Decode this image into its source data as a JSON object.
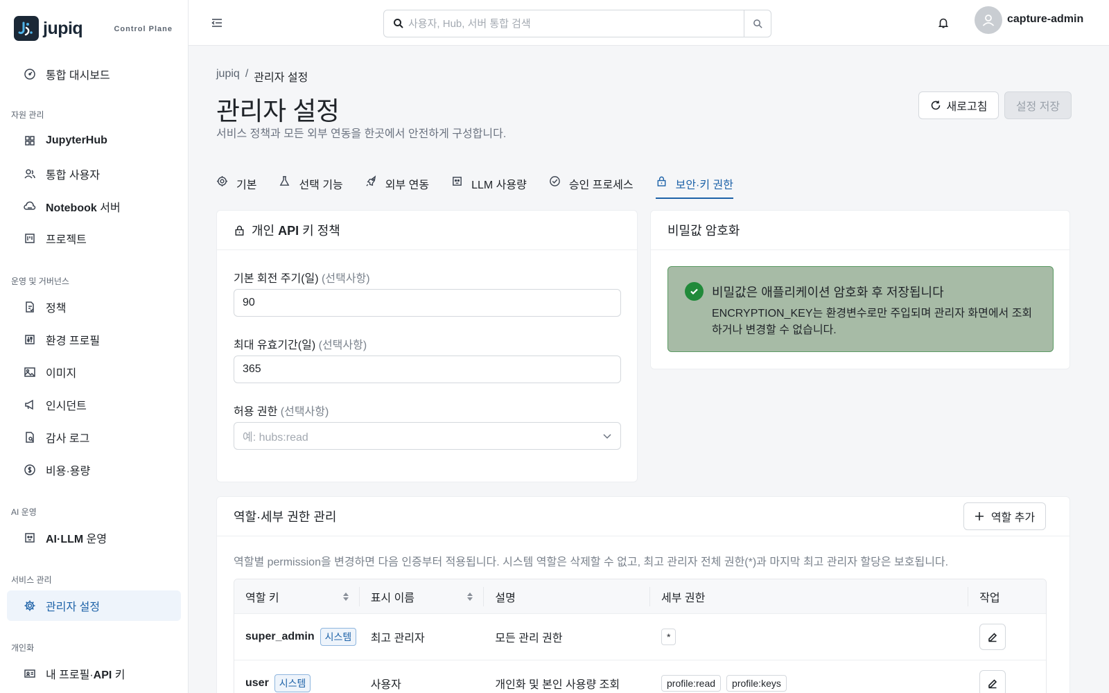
{
  "brand": {
    "name": "jupiq",
    "subtitle": "Control Plane"
  },
  "sidebar": {
    "dashboard": "통합 대시보드",
    "sections": {
      "resources": "자원 관리",
      "ops": "운영 및 거버넌스",
      "ai": "AI 운영",
      "service": "서비스 관리",
      "personal": "개인화"
    },
    "items": {
      "jupyterhub": "JupyterHub",
      "users": "통합 사용자",
      "notebook_strong": "Notebook",
      "notebook_rest": " 서버",
      "projects": "프로젝트",
      "policy": "정책",
      "env_profile": "환경 프로필",
      "images": "이미지",
      "incidents": "인시던트",
      "audit": "감사 로그",
      "cost": "비용·용량",
      "ai_llm": "AI·LLM",
      "ai_llm_rest": " 운영",
      "admin_settings": "관리자 설정",
      "profile_pre": "내 프로필·",
      "profile_strong": "API",
      "profile_rest": " 키"
    }
  },
  "topbar": {
    "search_placeholder": "사용자, Hub, 서버 통합 검색",
    "user": "capture-admin"
  },
  "main": {
    "breadcrumb": [
      "jupiq",
      "/",
      "관리자 설정"
    ],
    "title": "관리자 설정",
    "description": "서비스 정책과 모든 외부 연동을 한곳에서 안전하게 구성합니다.",
    "refresh_label": "새로고침",
    "save_label": "설정 저장",
    "tabs": [
      "기본",
      "선택 기능",
      "외부 연동",
      "LLM 사용량",
      "승인 프로세스",
      "보안·키 권한"
    ]
  },
  "api_key_policy": {
    "title_pre": "개인 ",
    "title_strong": "API",
    "title_rest": " 키 정책",
    "optional": "(선택사항)",
    "rotation_label": "기본 회전 주기(일)",
    "rotation_value": "90",
    "max_valid_label": "최대 유효기간(일)",
    "max_valid_value": "365",
    "allowed_perm_label": "허용 권한",
    "allowed_perm_placeholder": "예: hubs:read"
  },
  "encryption": {
    "title": "비밀값 암호화",
    "alert_title": "비밀값은 애플리케이션 암호화 후 저장됩니다",
    "alert_body": "ENCRYPTION_KEY는 환경변수로만 주입되며 관리자 화면에서 조회하거나 변경할 수 없습니다."
  },
  "roles": {
    "title": "역할·세부 권한 관리",
    "add_label": "역할 추가",
    "description": "역할별 permission을 변경하면 다음 인증부터 적용됩니다. 시스템 역할은 삭제할 수 없고, 최고 관리자 전체 권한(*)과 마지막 최고 관리자 할당은 보호됩니다.",
    "columns": [
      "역할 키",
      "표시 이름",
      "설명",
      "세부 권한",
      "작업"
    ],
    "rows": [
      {
        "key": "super_admin",
        "badge": "시스템",
        "display": "최고 관리자",
        "desc": "모든 관리 권한",
        "perms": [
          "*"
        ]
      },
      {
        "key": "user",
        "badge": "시스템",
        "display": "사용자",
        "desc": "개인화 및 본인 사용량 조회",
        "perms": [
          "profile:read",
          "profile:keys"
        ]
      }
    ]
  },
  "colors": {
    "accent": "#1d62a8",
    "success": "#218a3a",
    "alert_bg": "#a7bba6"
  }
}
